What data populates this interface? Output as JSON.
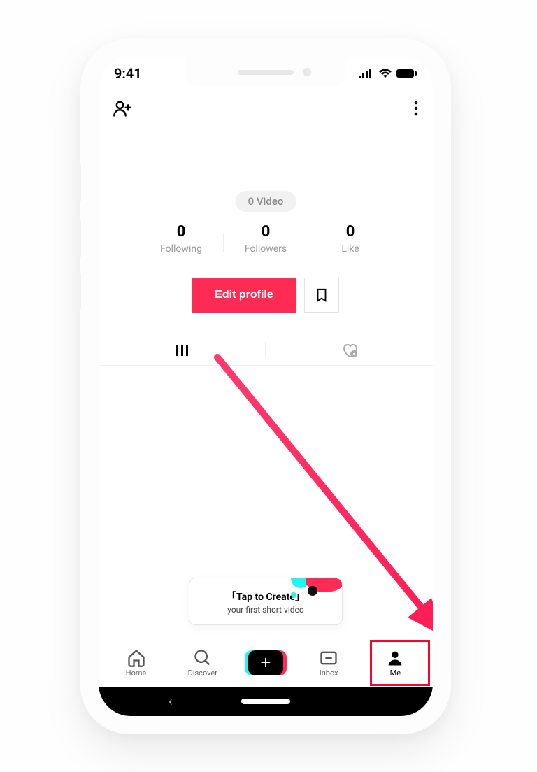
{
  "status": {
    "time": "9:41"
  },
  "profile": {
    "video_pill": "0 Video",
    "stats": [
      {
        "value": "0",
        "label": "Following"
      },
      {
        "value": "0",
        "label": "Followers"
      },
      {
        "value": "0",
        "label": "Like"
      }
    ],
    "edit_button": "Edit profile"
  },
  "tooltip": {
    "title": "「Tap to Create」",
    "subtitle": "your first short video"
  },
  "nav": {
    "home": "Home",
    "discover": "Discover",
    "inbox": "Inbox",
    "me": "Me"
  }
}
